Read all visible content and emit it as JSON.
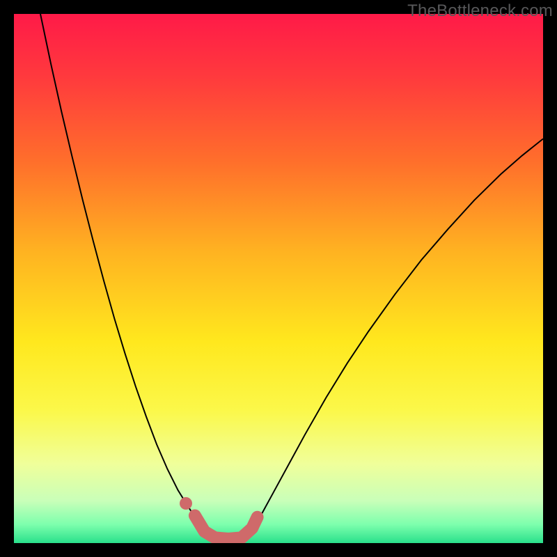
{
  "watermark": "TheBottleneck.com",
  "chart_data": {
    "type": "line",
    "title": "",
    "xlabel": "",
    "ylabel": "",
    "xlim": [
      0,
      1
    ],
    "ylim": [
      0,
      1
    ],
    "background_gradient": {
      "stops": [
        {
          "offset": 0.0,
          "color": "#ff1a48"
        },
        {
          "offset": 0.12,
          "color": "#ff3a3d"
        },
        {
          "offset": 0.28,
          "color": "#ff6f2b"
        },
        {
          "offset": 0.45,
          "color": "#ffb321"
        },
        {
          "offset": 0.62,
          "color": "#ffe81e"
        },
        {
          "offset": 0.75,
          "color": "#fbf84a"
        },
        {
          "offset": 0.85,
          "color": "#f0ff9a"
        },
        {
          "offset": 0.92,
          "color": "#c9ffb9"
        },
        {
          "offset": 0.965,
          "color": "#7dffad"
        },
        {
          "offset": 1.0,
          "color": "#29e08b"
        }
      ]
    },
    "series": [
      {
        "name": "left-branch",
        "stroke": "#000000",
        "stroke_width": 2,
        "x": [
          0.05,
          0.07,
          0.09,
          0.11,
          0.13,
          0.15,
          0.17,
          0.19,
          0.21,
          0.23,
          0.25,
          0.27,
          0.29,
          0.31,
          0.323,
          0.335,
          0.345,
          0.355,
          0.365,
          0.375
        ],
        "y": [
          1.0,
          0.905,
          0.815,
          0.73,
          0.648,
          0.57,
          0.495,
          0.424,
          0.358,
          0.296,
          0.239,
          0.186,
          0.14,
          0.1,
          0.079,
          0.06,
          0.046,
          0.032,
          0.02,
          0.01
        ]
      },
      {
        "name": "right-branch",
        "stroke": "#000000",
        "stroke_width": 2,
        "x": [
          0.44,
          0.46,
          0.49,
          0.52,
          0.55,
          0.59,
          0.63,
          0.67,
          0.72,
          0.77,
          0.82,
          0.87,
          0.92,
          0.96,
          1.0
        ],
        "y": [
          0.01,
          0.04,
          0.095,
          0.15,
          0.205,
          0.275,
          0.34,
          0.4,
          0.47,
          0.535,
          0.593,
          0.648,
          0.697,
          0.732,
          0.764
        ]
      },
      {
        "name": "valley-marker",
        "type": "thick-overlay",
        "stroke": "#cf6a6a",
        "stroke_width": 18,
        "linecap": "round",
        "x": [
          0.342,
          0.36,
          0.38,
          0.405,
          0.43,
          0.45,
          0.46
        ],
        "y": [
          0.052,
          0.022,
          0.01,
          0.008,
          0.01,
          0.028,
          0.049
        ]
      }
    ],
    "dots": [
      {
        "name": "valley-dot-upper",
        "cx": 0.325,
        "cy": 0.075,
        "r": 9,
        "fill": "#cf6a6a"
      }
    ]
  }
}
